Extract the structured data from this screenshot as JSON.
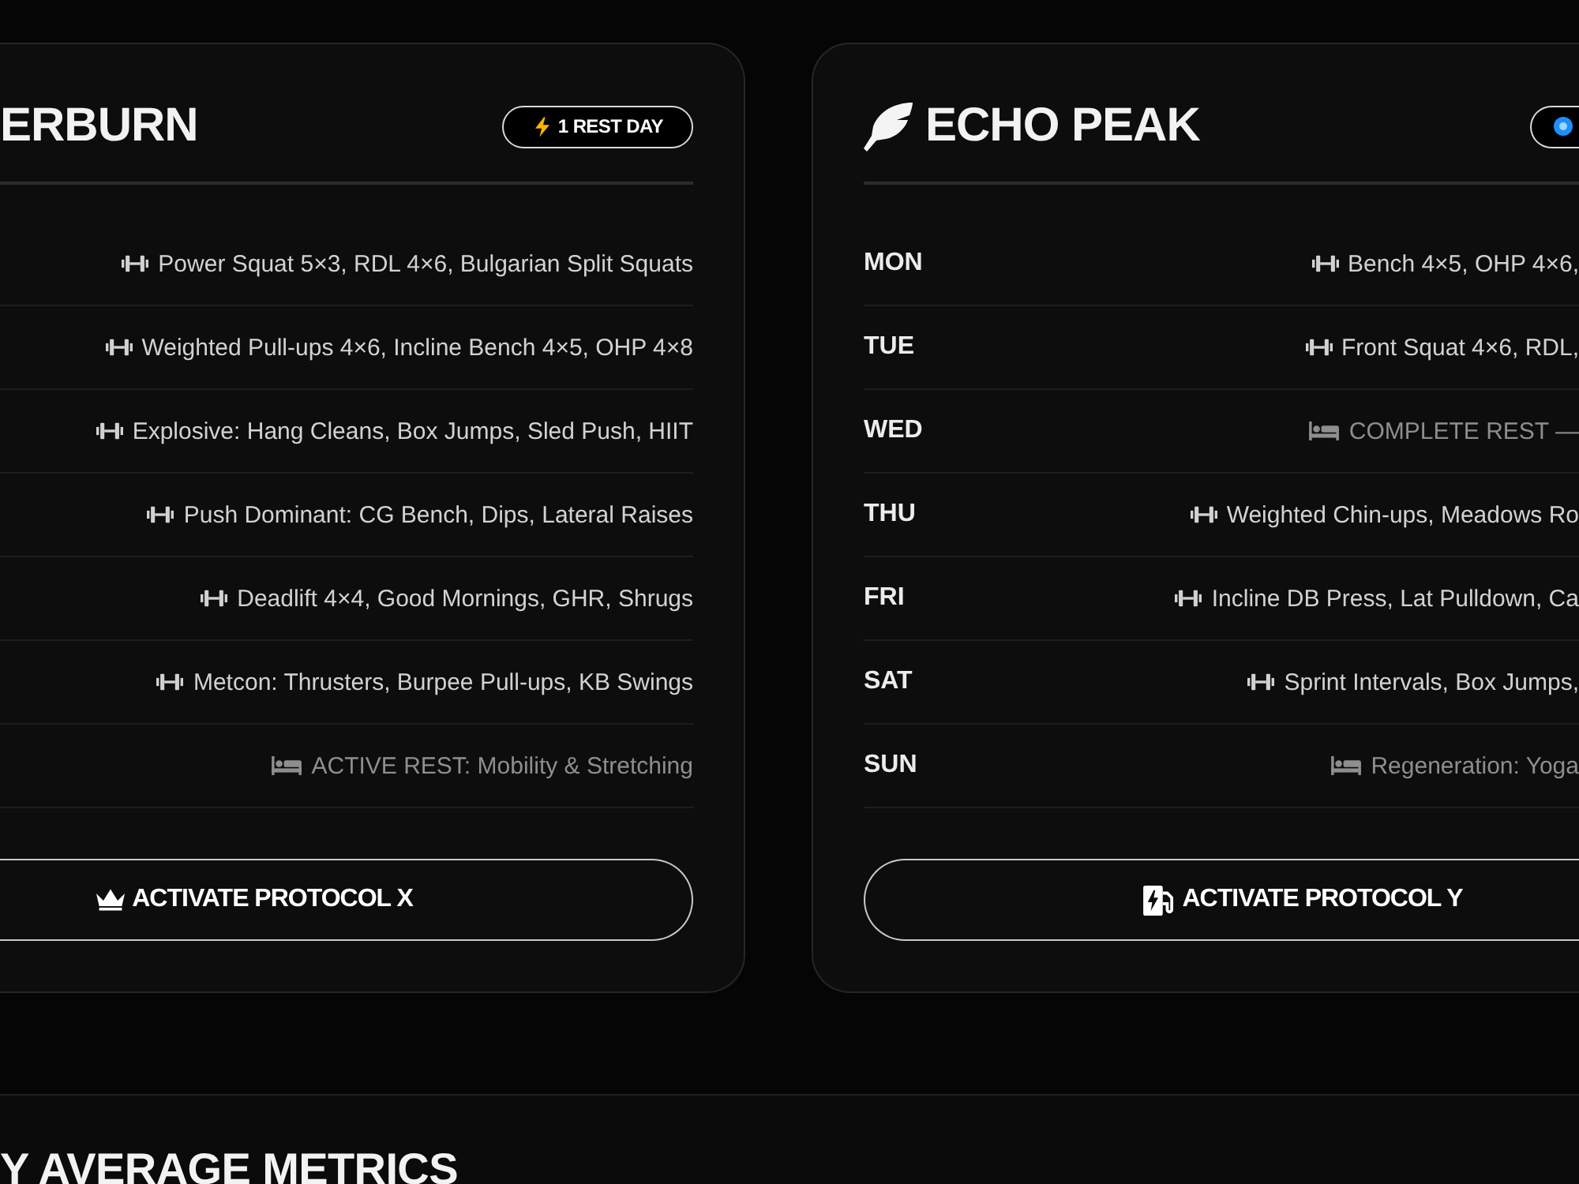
{
  "cards": [
    {
      "title": "ERBURN",
      "badge": {
        "text": "1 REST DAY"
      },
      "days": [
        {
          "kind": "training",
          "workout": "Power Squat 5×3, RDL 4×6, Bulgarian Split Squats"
        },
        {
          "kind": "training",
          "workout": "Weighted Pull-ups 4×6, Incline Bench 4×5, OHP 4×8"
        },
        {
          "kind": "training",
          "workout": "Explosive: Hang Cleans, Box Jumps, Sled Push, HIIT"
        },
        {
          "kind": "training",
          "workout": "Push Dominant: CG Bench, Dips, Lateral Raises"
        },
        {
          "kind": "training",
          "workout": "Deadlift 4×4, Good Mornings, GHR, Shrugs"
        },
        {
          "kind": "training",
          "workout": "Metcon: Thrusters, Burpee Pull-ups, KB Swings"
        },
        {
          "kind": "rest",
          "workout": "ACTIVE REST: Mobility & Stretching"
        }
      ],
      "button": {
        "label": "ACTIVATE PROTOCOL X"
      }
    },
    {
      "title": "ECHO PEAK",
      "days": [
        {
          "day": "MON",
          "kind": "training",
          "workout": "Bench 4×5, OHP 4×6,"
        },
        {
          "day": "TUE",
          "kind": "training",
          "workout": "Front Squat 4×6, RDL,"
        },
        {
          "day": "WED",
          "kind": "rest",
          "workout": "COMPLETE REST —"
        },
        {
          "day": "THU",
          "kind": "training",
          "workout": "Weighted Chin-ups, Meadows Ro"
        },
        {
          "day": "FRI",
          "kind": "training",
          "workout": "Incline DB Press, Lat Pulldown, Ca"
        },
        {
          "day": "SAT",
          "kind": "training",
          "workout": "Sprint Intervals, Box Jumps,"
        },
        {
          "day": "SUN",
          "kind": "rest",
          "workout": "Regeneration: Yoga"
        }
      ],
      "button": {
        "label": "ACTIVATE PROTOCOL Y"
      }
    }
  ],
  "section": {
    "title": "Y AVERAGE METRICS"
  }
}
